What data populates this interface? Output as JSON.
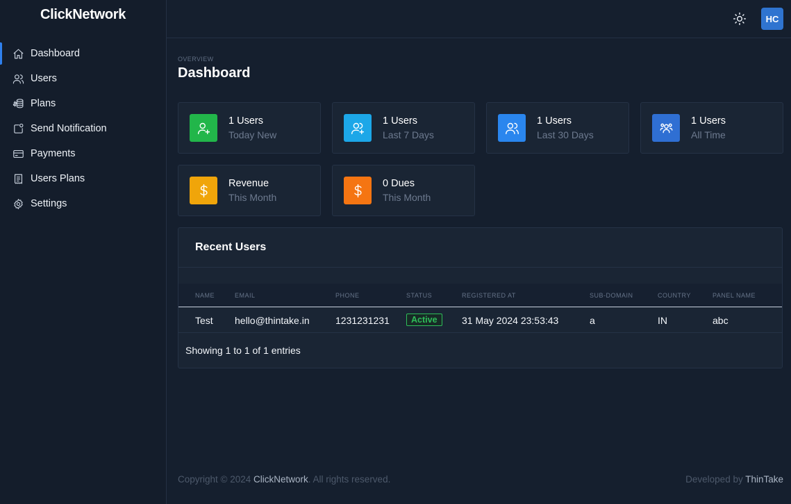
{
  "app": {
    "brand": "ClickNetwork",
    "avatar_initials": "HC"
  },
  "sidebar": {
    "items": [
      {
        "label": "Dashboard",
        "icon": "home-icon",
        "active": true
      },
      {
        "label": "Users",
        "icon": "users-icon"
      },
      {
        "label": "Plans",
        "icon": "coins-icon"
      },
      {
        "label": "Send Notification",
        "icon": "notification-icon"
      },
      {
        "label": "Payments",
        "icon": "credit-card-icon"
      },
      {
        "label": "Users Plans",
        "icon": "receipt-icon"
      },
      {
        "label": "Settings",
        "icon": "gear-icon"
      }
    ]
  },
  "header": {
    "overline": "OVERVIEW",
    "title": "Dashboard"
  },
  "stats": [
    {
      "value": "1 Users",
      "label": "Today New",
      "color": "#22b64a",
      "icon": "user-plus-icon"
    },
    {
      "value": "1 Users",
      "label": "Last 7 Days",
      "color": "#1ca7e8",
      "icon": "users-plus-icon"
    },
    {
      "value": "1 Users",
      "label": "Last 30 Days",
      "color": "#2a86ee",
      "icon": "users-icon"
    },
    {
      "value": "1 Users",
      "label": "All Time",
      "color": "#2f6fd3",
      "icon": "group-icon"
    },
    {
      "value": "Revenue",
      "label": "This Month",
      "color": "#f0a50a",
      "icon": "dollar-icon"
    },
    {
      "value": "0 Dues",
      "label": "This Month",
      "color": "#f57512",
      "icon": "dollar-icon"
    }
  ],
  "recent_users": {
    "title": "Recent Users",
    "columns": [
      "NAME",
      "EMAIL",
      "PHONE",
      "STATUS",
      "REGISTERED AT",
      "SUB-DOMAIN",
      "COUNTRY",
      "PANEL NAME"
    ],
    "rows": [
      {
        "name": "Test",
        "email": "hello@thintake.in",
        "phone": "1231231231",
        "status": "Active",
        "registered_at": "31 May 2024 23:53:43",
        "sub_domain": "a",
        "country": "IN",
        "panel_name": "abc"
      }
    ],
    "entries": "Showing 1 to 1 of 1 entries"
  },
  "footer": {
    "copyright_prefix": "Copyright © 2024 ",
    "copyright_brand": "ClickNetwork",
    "copyright_suffix": ". All rights reserved.",
    "developed_prefix": "Developed by ",
    "developed_brand": "ThinTake"
  },
  "colors": {
    "accent": "#2f80ed",
    "background": "#151f2e",
    "status_active": "#2ebd59"
  }
}
